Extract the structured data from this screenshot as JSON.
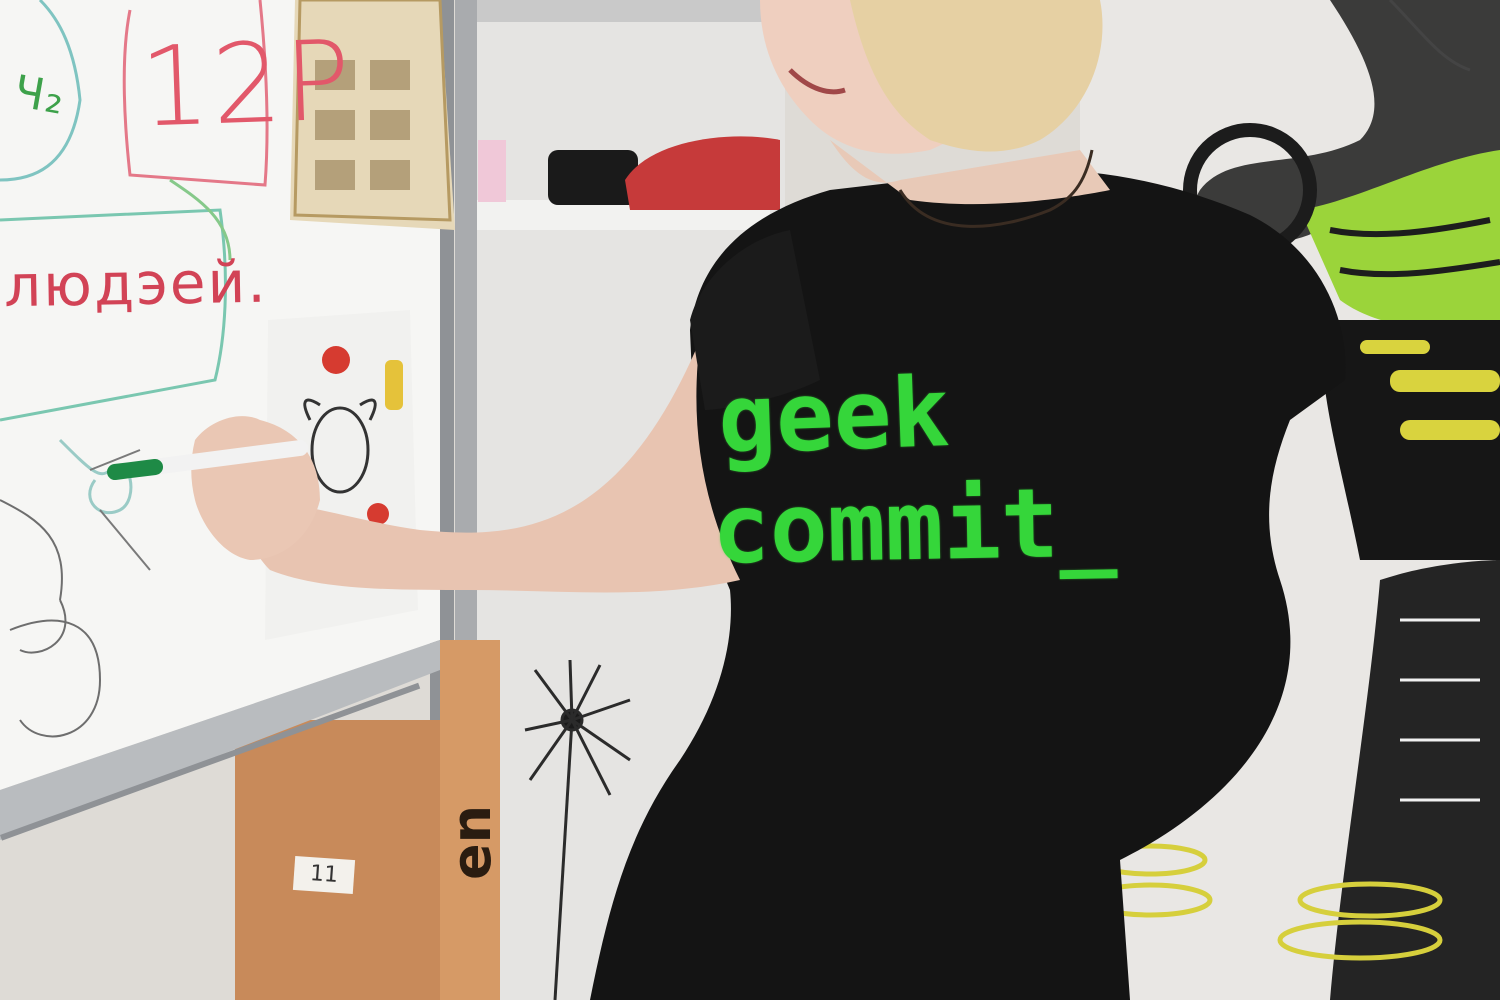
{
  "photo": {
    "shirt": {
      "line1": "geek",
      "line2": "commit_",
      "text_color": "#35d63a",
      "shirt_color": "#141414"
    },
    "whiteboard": {
      "price_label": "12P",
      "word": "людэей.",
      "corner_mark": "Ч₂",
      "marker_color": "#d24356"
    },
    "box_label": "11",
    "box_brand": "en"
  }
}
